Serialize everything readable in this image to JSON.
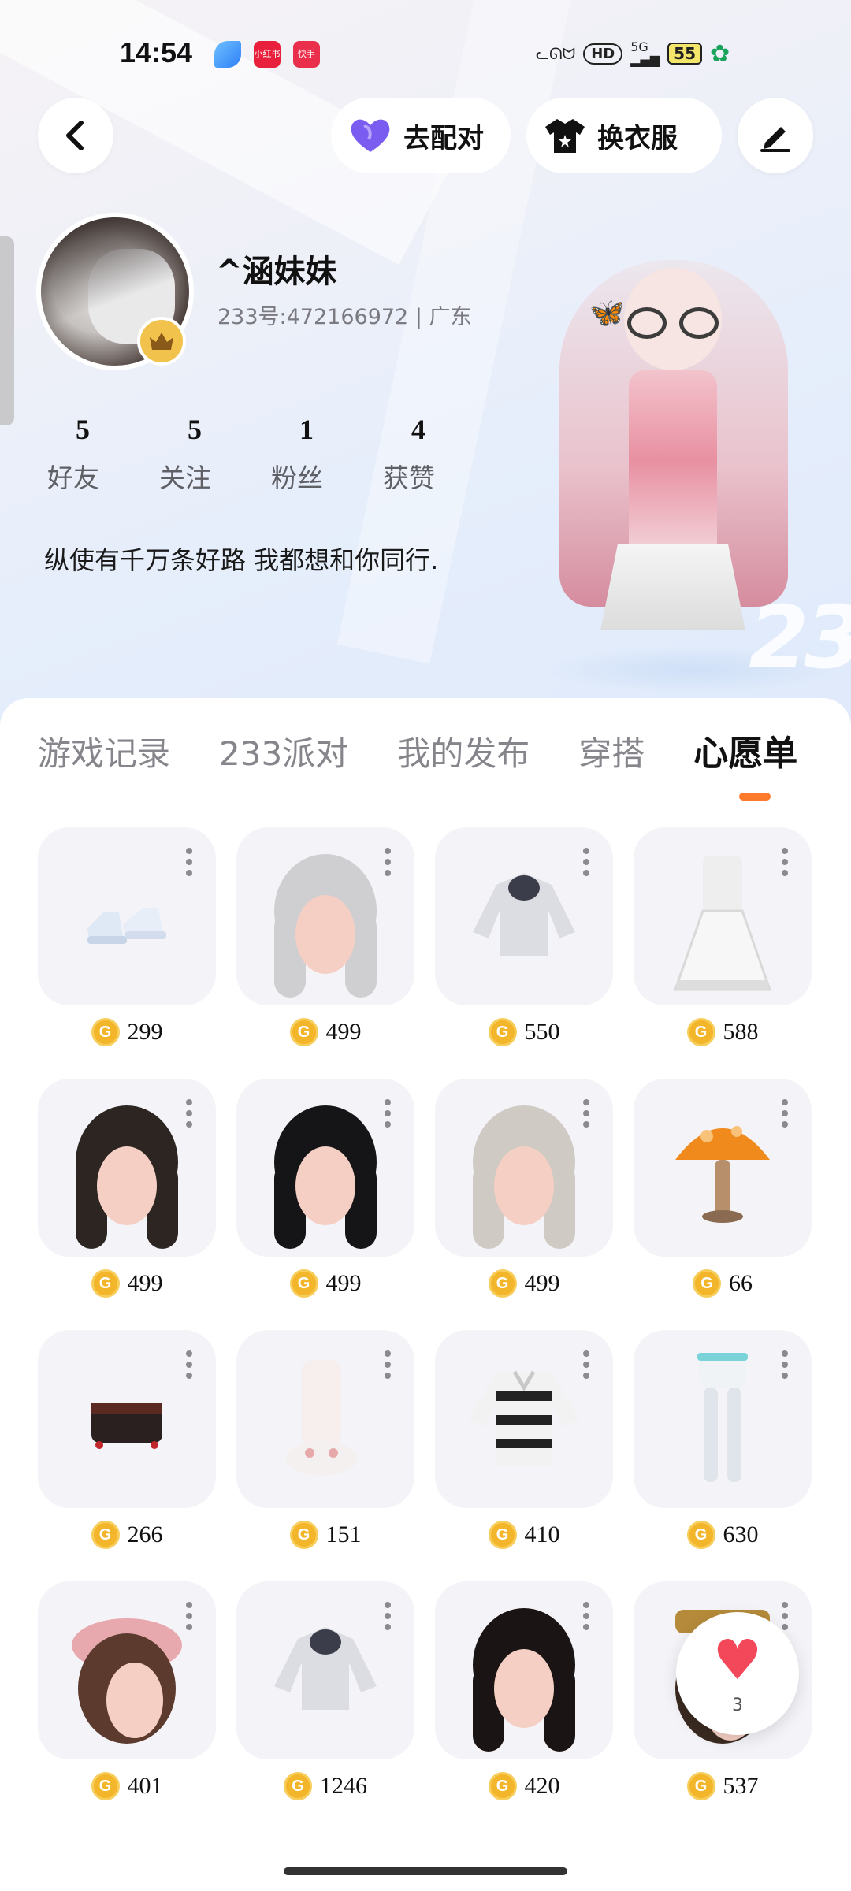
{
  "status_bar": {
    "time": "14:54",
    "apps": [
      "小红书",
      "快手"
    ],
    "network": "5G",
    "hd": "HD",
    "battery": "55"
  },
  "top_actions": {
    "match_label": "去配对",
    "dress_label": "换衣服"
  },
  "profile": {
    "name": "^涵妹妹",
    "id_line": "233号:472166972 | 广东",
    "stats": [
      {
        "value": "5",
        "label": "好友"
      },
      {
        "value": "5",
        "label": "关注"
      },
      {
        "value": "1",
        "label": "粉丝"
      },
      {
        "value": "4",
        "label": "获赞"
      }
    ],
    "bio": "纵使有千万条好路 我都想和你同行.",
    "watermark": "233"
  },
  "tabs": [
    {
      "label": "游戏记录",
      "active": false
    },
    {
      "label": "233派对",
      "active": false
    },
    {
      "label": "我的发布",
      "active": false
    },
    {
      "label": "穿搭",
      "active": false
    },
    {
      "label": "心愿单",
      "active": true
    }
  ],
  "wishlist": [
    {
      "price": "299",
      "item": "shoes-icon"
    },
    {
      "price": "499",
      "item": "hair-icon"
    },
    {
      "price": "550",
      "item": "hoodie-icon"
    },
    {
      "price": "588",
      "item": "dress-icon"
    },
    {
      "price": "499",
      "item": "hair-icon"
    },
    {
      "price": "499",
      "item": "hair-icon"
    },
    {
      "price": "499",
      "item": "hair-icon"
    },
    {
      "price": "66",
      "item": "mushroom-icon"
    },
    {
      "price": "266",
      "item": "bag-icon"
    },
    {
      "price": "151",
      "item": "boots-icon"
    },
    {
      "price": "410",
      "item": "sweater-icon"
    },
    {
      "price": "630",
      "item": "pants-icon"
    },
    {
      "price": "401",
      "item": "hat-icon"
    },
    {
      "price": "1246",
      "item": "hoodie-icon"
    },
    {
      "price": "420",
      "item": "hair-icon"
    },
    {
      "price": "537",
      "item": "accessory-icon"
    }
  ],
  "like_fab": {
    "count": "3"
  },
  "colors": {
    "accent": "#ff7a2a",
    "coin": "#f3b52a",
    "heart": "#f2485a",
    "match_heart": "#7b5cf0"
  }
}
